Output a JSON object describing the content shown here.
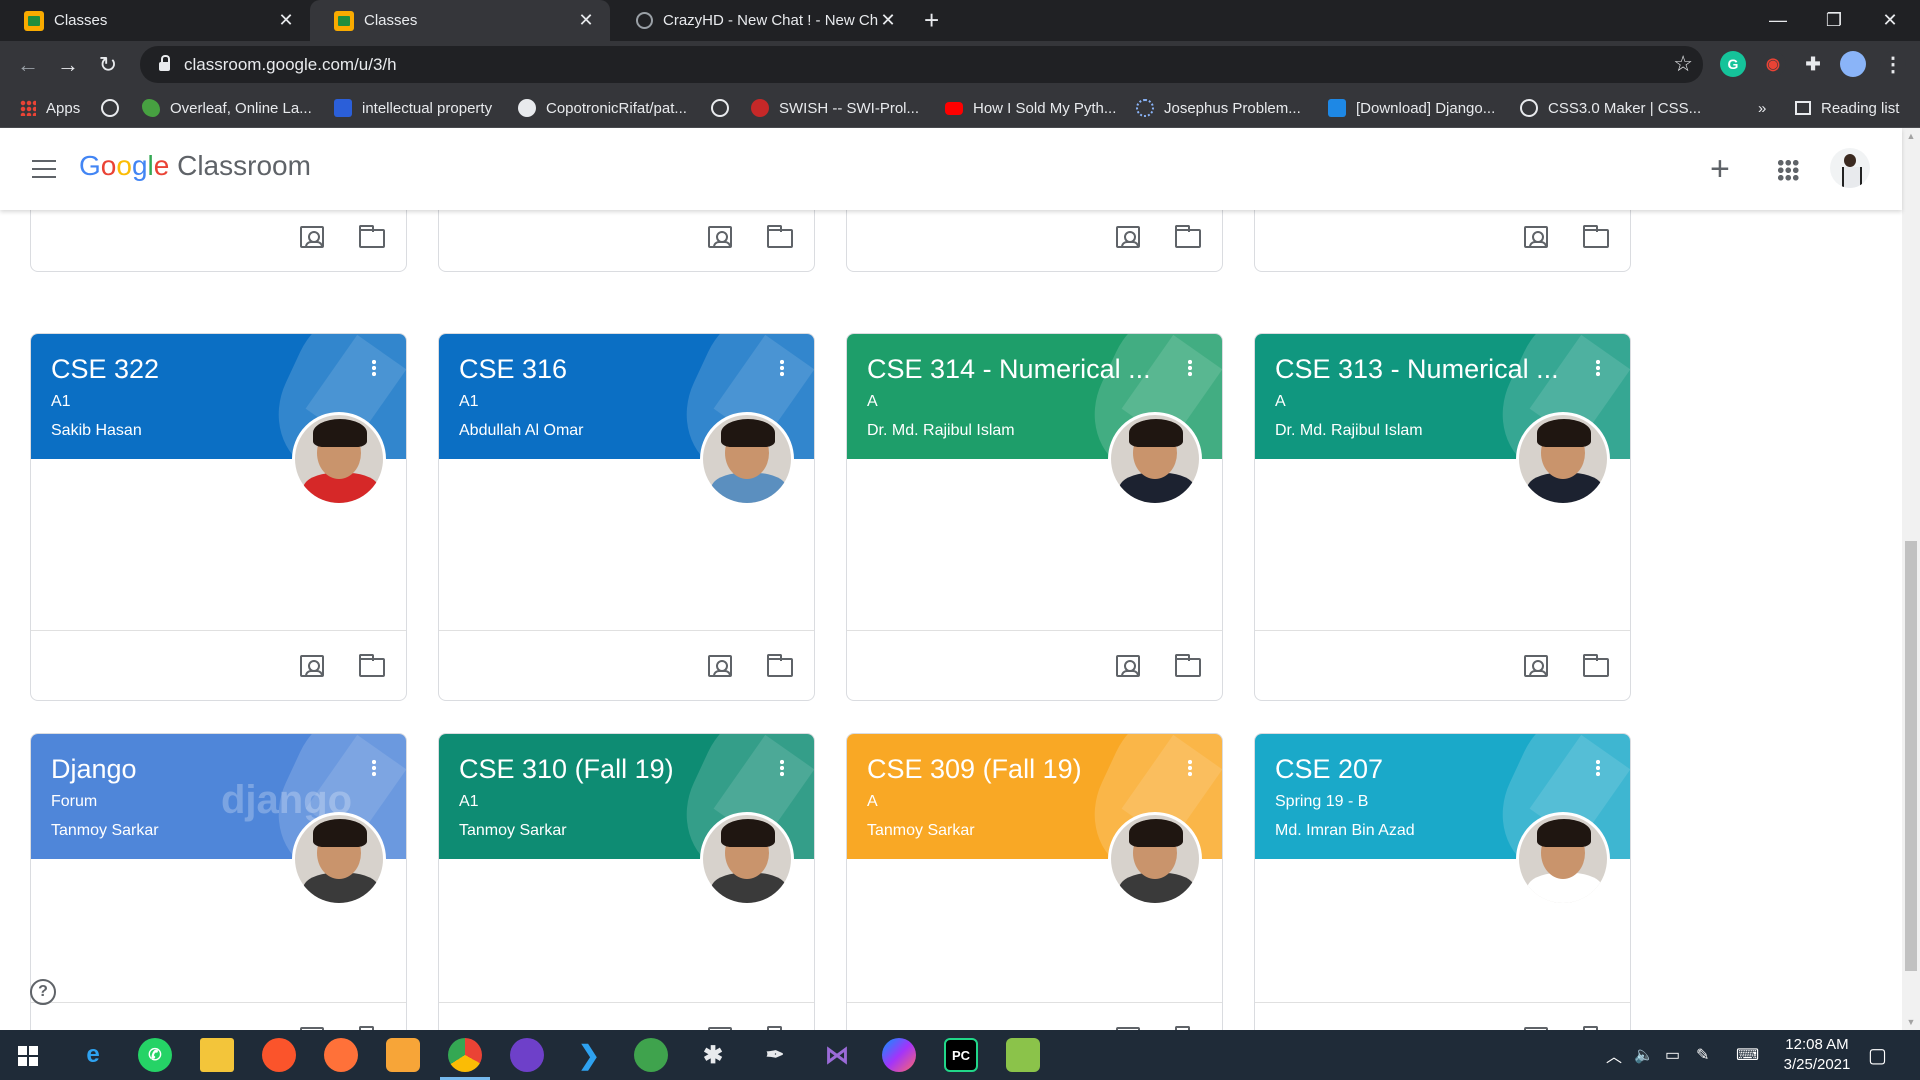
{
  "browser": {
    "tabs": [
      {
        "title": "Classes",
        "active": false,
        "favicon": "classroom-favicon"
      },
      {
        "title": "Classes",
        "active": true,
        "favicon": "classroom-favicon"
      },
      {
        "title": "CrazyHD - New Chat ! - New Cha",
        "active": false,
        "favicon": "globe-favicon"
      }
    ],
    "new_tab_glyph": "+",
    "window_controls": {
      "minimize": "—",
      "restore": "❐",
      "close": "✕"
    },
    "url": "classroom.google.com/u/3/h",
    "bookmarks": [
      {
        "label": "Apps",
        "icon": "apps-grid-icon"
      },
      {
        "label": "",
        "icon": "globe-icon"
      },
      {
        "label": "Overleaf, Online La...",
        "icon": "overleaf-icon"
      },
      {
        "label": "intellectual property",
        "icon": "s-icon"
      },
      {
        "label": "CopotronicRifat/pat...",
        "icon": "github-icon"
      },
      {
        "label": "",
        "icon": "globe-icon"
      },
      {
        "label": "SWISH -- SWI-Prol...",
        "icon": "swish-icon"
      },
      {
        "label": "How I Sold My Pyth...",
        "icon": "youtube-icon"
      },
      {
        "label": "Josephus Problem...",
        "icon": "loading-icon"
      },
      {
        "label": "[Download] Django...",
        "icon": "site-icon"
      },
      {
        "label": "CSS3.0 Maker | CSS...",
        "icon": "globe-icon"
      }
    ],
    "bookmarks_overflow": "»",
    "reading_list": "Reading list"
  },
  "header": {
    "brand_google": [
      "G",
      "o",
      "o",
      "g",
      "l",
      "e"
    ],
    "brand_colors": [
      "#4285f4",
      "#ea4335",
      "#fbbc05",
      "#4285f4",
      "#34a853",
      "#ea4335"
    ],
    "brand_product": "Classroom",
    "create_glyph": "+"
  },
  "cards": [
    {
      "title": "",
      "section": "",
      "teacher": "",
      "theme": "#ffffff"
    },
    {
      "title": "",
      "section": "",
      "teacher": "",
      "theme": "#ffffff"
    },
    {
      "title": "",
      "section": "",
      "teacher": "",
      "theme": "#ffffff"
    },
    {
      "title": "",
      "section": "",
      "teacher": "",
      "theme": "#ffffff"
    },
    {
      "title": "CSE 322",
      "section": "A1",
      "teacher": "Sakib Hasan",
      "theme": "#0b6fc4",
      "shirt": "#d62828"
    },
    {
      "title": "CSE 316",
      "section": "A1",
      "teacher": "Abdullah Al Omar",
      "theme": "#0b6fc4",
      "shirt": "#5b8fbf"
    },
    {
      "title": "CSE 314 - Numerical ...",
      "section": "A",
      "teacher": "Dr. Md. Rajibul Islam",
      "theme": "#1e9e6a",
      "shirt": "#1c2230"
    },
    {
      "title": "CSE 313 - Numerical ...",
      "section": "A",
      "teacher": "Dr. Md. Rajibul Islam",
      "theme": "#10977f",
      "shirt": "#1c2230"
    },
    {
      "title": "Django",
      "section": "Forum",
      "teacher": "Tanmoy Sarkar",
      "theme": "#4f86d9",
      "shirt": "#3a3a3a",
      "watermark": "django"
    },
    {
      "title": "CSE 310 (Fall 19)",
      "section": "A1",
      "teacher": "Tanmoy Sarkar",
      "theme": "#0e8c73",
      "shirt": "#3a3a3a"
    },
    {
      "title": "CSE 309 (Fall 19)",
      "section": "A",
      "teacher": "Tanmoy Sarkar",
      "theme": "#f9a825",
      "shirt": "#3a3a3a"
    },
    {
      "title": "CSE 207",
      "section": "Spring 19 - B",
      "teacher": "Md. Imran Bin Azad",
      "theme": "#1aa9c9",
      "shirt": "#ffffff"
    }
  ],
  "help_glyph": "?",
  "taskbar": {
    "apps": [
      "start",
      "edge-legacy",
      "whatsapp",
      "file-explorer",
      "brave",
      "firefox",
      "photo-app",
      "chrome",
      "github-desktop",
      "vscode",
      "photo-viewer",
      "fan-app",
      "inkscape",
      "visual-studio",
      "messenger",
      "pycharm",
      "notepad-plus"
    ],
    "time": "12:08 AM",
    "date": "3/25/2021"
  }
}
